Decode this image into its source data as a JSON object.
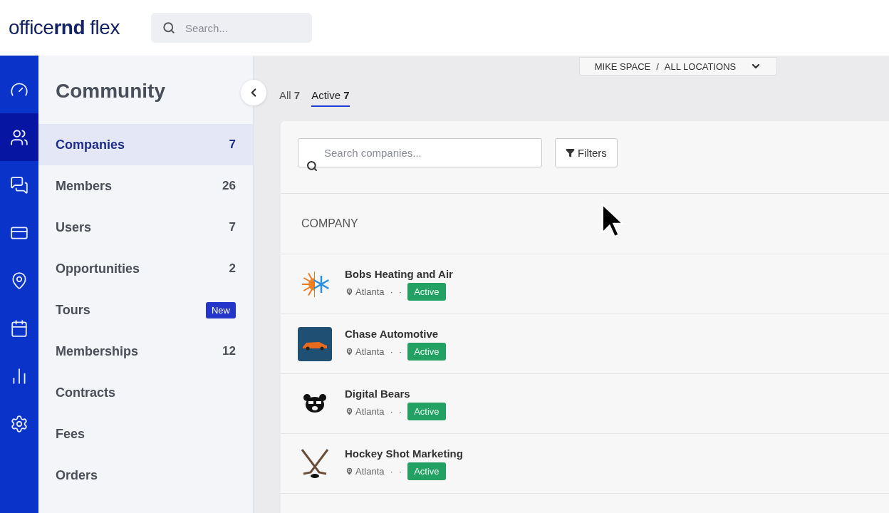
{
  "header": {
    "logo": "office**rnd** flex",
    "search": {
      "placeholder": "Search..."
    }
  },
  "rail": [
    {
      "selected": false
    },
    {
      "selected": true
    },
    {
      "selected": false
    },
    {
      "selected": false
    },
    {
      "selected": false
    },
    {
      "selected": false
    },
    {
      "selected": false
    },
    {
      "selected": false
    }
  ],
  "sidebar": {
    "title": "Community",
    "items": [
      {
        "label": "Companies",
        "count": "7",
        "selected": true
      },
      {
        "label": "Members",
        "count": "26",
        "selected": false
      },
      {
        "label": "Users",
        "count": "7",
        "selected": false
      },
      {
        "label": "Opportunities",
        "count": "2",
        "selected": false
      },
      {
        "label": "Tours",
        "badge": "New",
        "selected": false
      },
      {
        "label": "Memberships",
        "count": "12",
        "selected": false
      },
      {
        "label": "Contracts",
        "selected": false
      },
      {
        "label": "Fees",
        "selected": false
      },
      {
        "label": "Orders",
        "selected": false
      }
    ]
  },
  "location_picker": {
    "space": "MIKE SPACE",
    "separator": "/",
    "location": "ALL LOCATIONS"
  },
  "tabs": [
    {
      "label": "All",
      "count": "7",
      "selected": false
    },
    {
      "label": "Active",
      "count": "7",
      "selected": true
    }
  ],
  "search": {
    "placeholder": "Search companies..."
  },
  "filters_button": "Filters",
  "table": {
    "column": "COMPANY",
    "rows": [
      {
        "kind": "sun-snow",
        "name": "Bobs Heating and Air",
        "location": "Atlanta",
        "separator_1": "·",
        "separator_2": "·",
        "status": "Active"
      },
      {
        "kind": "car",
        "name": "Chase Automotive",
        "location": "Atlanta",
        "separator_1": "·",
        "separator_2": "·",
        "status": "Active"
      },
      {
        "kind": "bear",
        "name": "Digital Bears",
        "location": "Atlanta",
        "separator_1": "·",
        "separator_2": "·",
        "status": "Active"
      },
      {
        "kind": "hockey",
        "name": "Hockey Shot Marketing",
        "location": "Atlanta",
        "separator_1": "·",
        "separator_2": "·",
        "status": "Active"
      }
    ]
  }
}
